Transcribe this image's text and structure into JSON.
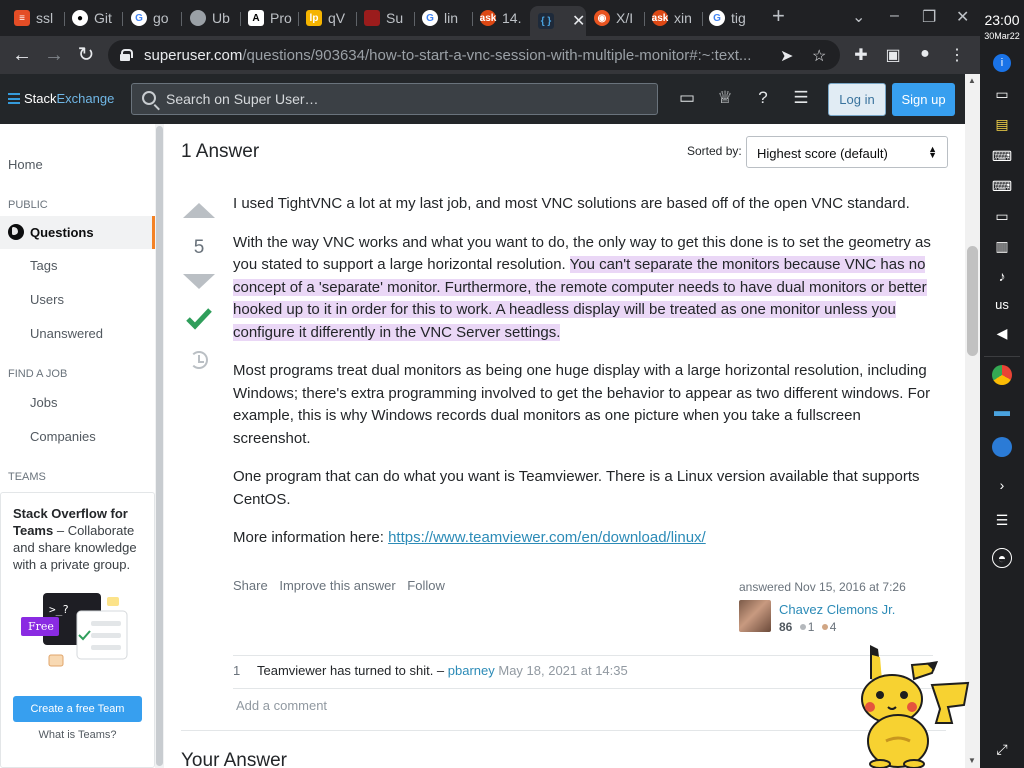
{
  "browser": {
    "tabs": [
      {
        "label": "ssl",
        "icon": "document-icon"
      },
      {
        "label": "Git",
        "icon": "github-icon"
      },
      {
        "label": "go",
        "icon": "google-icon"
      },
      {
        "label": "Ub",
        "icon": "globe-icon"
      },
      {
        "label": "Pro",
        "icon": "letter-a-icon"
      },
      {
        "label": "qV",
        "icon": "lp-icon"
      },
      {
        "label": "Su",
        "icon": "app-icon"
      },
      {
        "label": "lin",
        "icon": "google-icon"
      },
      {
        "label": "14.",
        "icon": "askubuntu-icon"
      },
      {
        "label": "",
        "icon": "superuser-icon"
      },
      {
        "label": "X/I",
        "icon": "ubuntu-icon"
      },
      {
        "label": "xin",
        "icon": "askubuntu-icon"
      },
      {
        "label": "tig",
        "icon": "google-icon"
      }
    ],
    "active_tab_close": "✕",
    "new_tab": "+",
    "url_host": "superuser.com",
    "url_path": "/questions/903634/how-to-start-a-vnc-session-with-multiple-monitor#:~:text..."
  },
  "dock": {
    "time": "23:00",
    "date": "30Mar22",
    "lang": "us"
  },
  "se_header": {
    "brand_stack": "Stack",
    "brand_exchange": "Exchange",
    "search_placeholder": "Search on Super User…",
    "login": "Log in",
    "signup": "Sign up"
  },
  "sidebar": {
    "home": "Home",
    "public_head": "PUBLIC",
    "questions": "Questions",
    "tags": "Tags",
    "users": "Users",
    "unanswered": "Unanswered",
    "find_job_head": "FIND A JOB",
    "jobs": "Jobs",
    "companies": "Companies",
    "teams_head": "TEAMS",
    "teams_title": "Stack Overflow for Teams",
    "teams_desc": " – Collaborate and share knowledge with a private group.",
    "free_badge": "Free",
    "create_team": "Create a free Team",
    "what_is_teams": "What is Teams?"
  },
  "answers": {
    "count_title": "1 Answer",
    "sorted_by": "Sorted by:",
    "sort_value": "Highest score (default)",
    "vote_count": "5",
    "p1": "I used TightVNC a lot at my last job, and most VNC solutions are based off of the open VNC standard.",
    "p2_plain": "With the way VNC works and what you want to do, the only way to get this done is to set the geometry as you stated to support a large horizontal resolution. ",
    "p2_highlight": "You can't separate the monitors because VNC has no concept of a 'separate' monitor. Furthermore, the remote computer needs to have dual monitors or better hooked up to it in order for this to work. A headless display will be treated as one monitor unless you configure it differently in the VNC Server settings.",
    "p3": "Most programs treat dual monitors as being one huge display with a large horizontal resolution, including Windows; there's extra programming involved to get the behavior to appear as two different windows. For example, this is why Windows records dual monitors as one picture when you take a fullscreen screenshot.",
    "p4": "One program that can do what you want is Teamviewer. There is a Linux version available that supports CentOS.",
    "p5_prefix": "More information here: ",
    "p5_link": "https://www.teamviewer.com/en/download/linux/",
    "share": "Share",
    "improve": "Improve this answer",
    "follow": "Follow",
    "answered": "answered Nov 15, 2016 at 7:26",
    "user_name": "Chavez Clemons Jr.",
    "user_rep": "86",
    "silver_badges": "1",
    "bronze_badges": "4",
    "comment_score": "1",
    "comment_text": "Teamviewer has turned to shit. – ",
    "comment_user": "pbarney",
    "comment_date": " May 18, 2021 at 14:35",
    "add_comment": "Add a comment",
    "your_answer": "Your Answer"
  },
  "colors": {
    "accent_orange": "#f48225",
    "accepted_green": "#2f9e5b",
    "link_blue": "#2c8bb7",
    "highlight": "#ead7f6"
  }
}
